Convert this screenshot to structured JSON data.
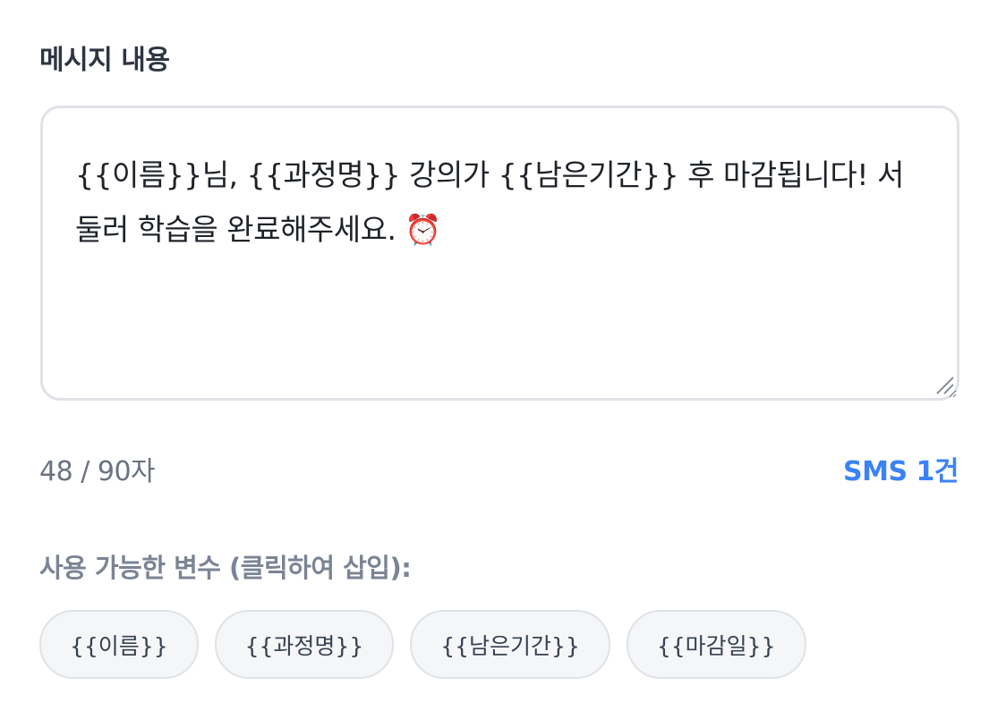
{
  "section_label": "메시지 내용",
  "message": {
    "text": "{{이름}}님, {{과정명}} 강의가 {{남은기간}} 후 마감됩니다! 서둘러 학습을 완료해주세요. ⏰"
  },
  "counter": {
    "text": "48 / 90자"
  },
  "sms": {
    "text": "SMS 1건",
    "color": "#3b82f6"
  },
  "variables": {
    "label": "사용 가능한 변수 (클릭하여 삽입):",
    "chips": [
      "{{이름}}",
      "{{과정명}}",
      "{{남은기간}}",
      "{{마감일}}"
    ]
  }
}
